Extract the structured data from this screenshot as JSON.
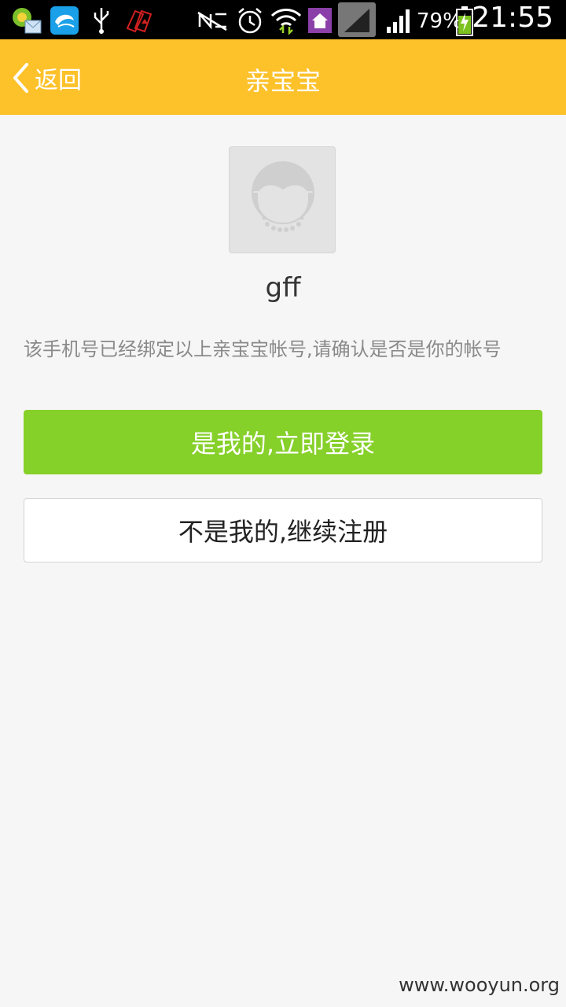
{
  "status_bar": {
    "battery_percent": "79%",
    "time": "21:55",
    "icons": [
      "app-icon",
      "chat-app-icon",
      "usb-icon",
      "cards-icon",
      "nfc-icon",
      "alarm-icon",
      "wifi-icon",
      "home-icon",
      "signal-icon",
      "signal-icon",
      "battery-icon"
    ]
  },
  "header": {
    "back_label": "返回",
    "title": "亲宝宝",
    "background": "#fdc12a"
  },
  "account": {
    "username": "gff",
    "notice": "该手机号已经绑定以上亲宝宝帐号,请确认是否是你的帐号"
  },
  "actions": {
    "login_label": "是我的,立即登录",
    "register_label": "不是我的,继续注册",
    "login_color": "#86d02a"
  },
  "watermark": "www.wooyun.org"
}
